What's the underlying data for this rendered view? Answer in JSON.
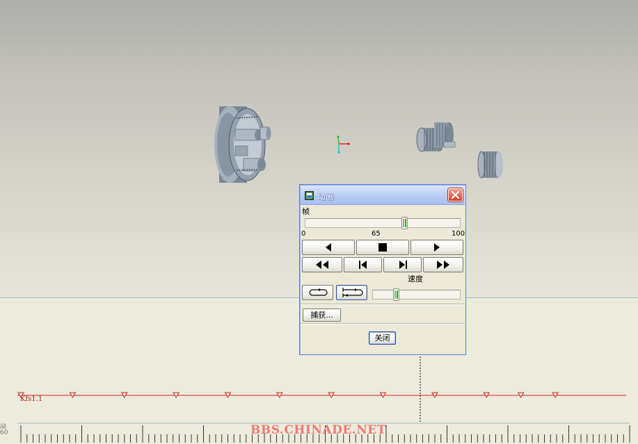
{
  "dialog": {
    "title": "动画",
    "frame_label": "帧",
    "frame_min": "0",
    "frame_value_label": "65",
    "frame_max": "100",
    "frame_fraction": 0.65,
    "speed_label": "速度",
    "speed_fraction": 0.25,
    "capture_label": "捕获...",
    "close_label": "关闭",
    "buttons": {
      "row1": [
        "play-reverse-icon",
        "stop-icon",
        "play-forward-icon"
      ],
      "row2": [
        "rewind-icon",
        "step-back-icon",
        "step-forward-icon",
        "fast-forward-icon"
      ],
      "row3": [
        "loop-icon",
        "bounce-icon"
      ]
    }
  },
  "timeline": {
    "track_label": "Kfs1.1",
    "side_labels": [
      "间",
      "60"
    ],
    "keyframe_count": 12,
    "colors": {
      "track": "#d42020",
      "ticks": "#333333"
    }
  },
  "watermark": "BBS.CHINADE.NET",
  "colors": {
    "title_bar": "#b8cdf3",
    "dialog_bg": "#ece9d8",
    "close_button": "#d5402a"
  }
}
